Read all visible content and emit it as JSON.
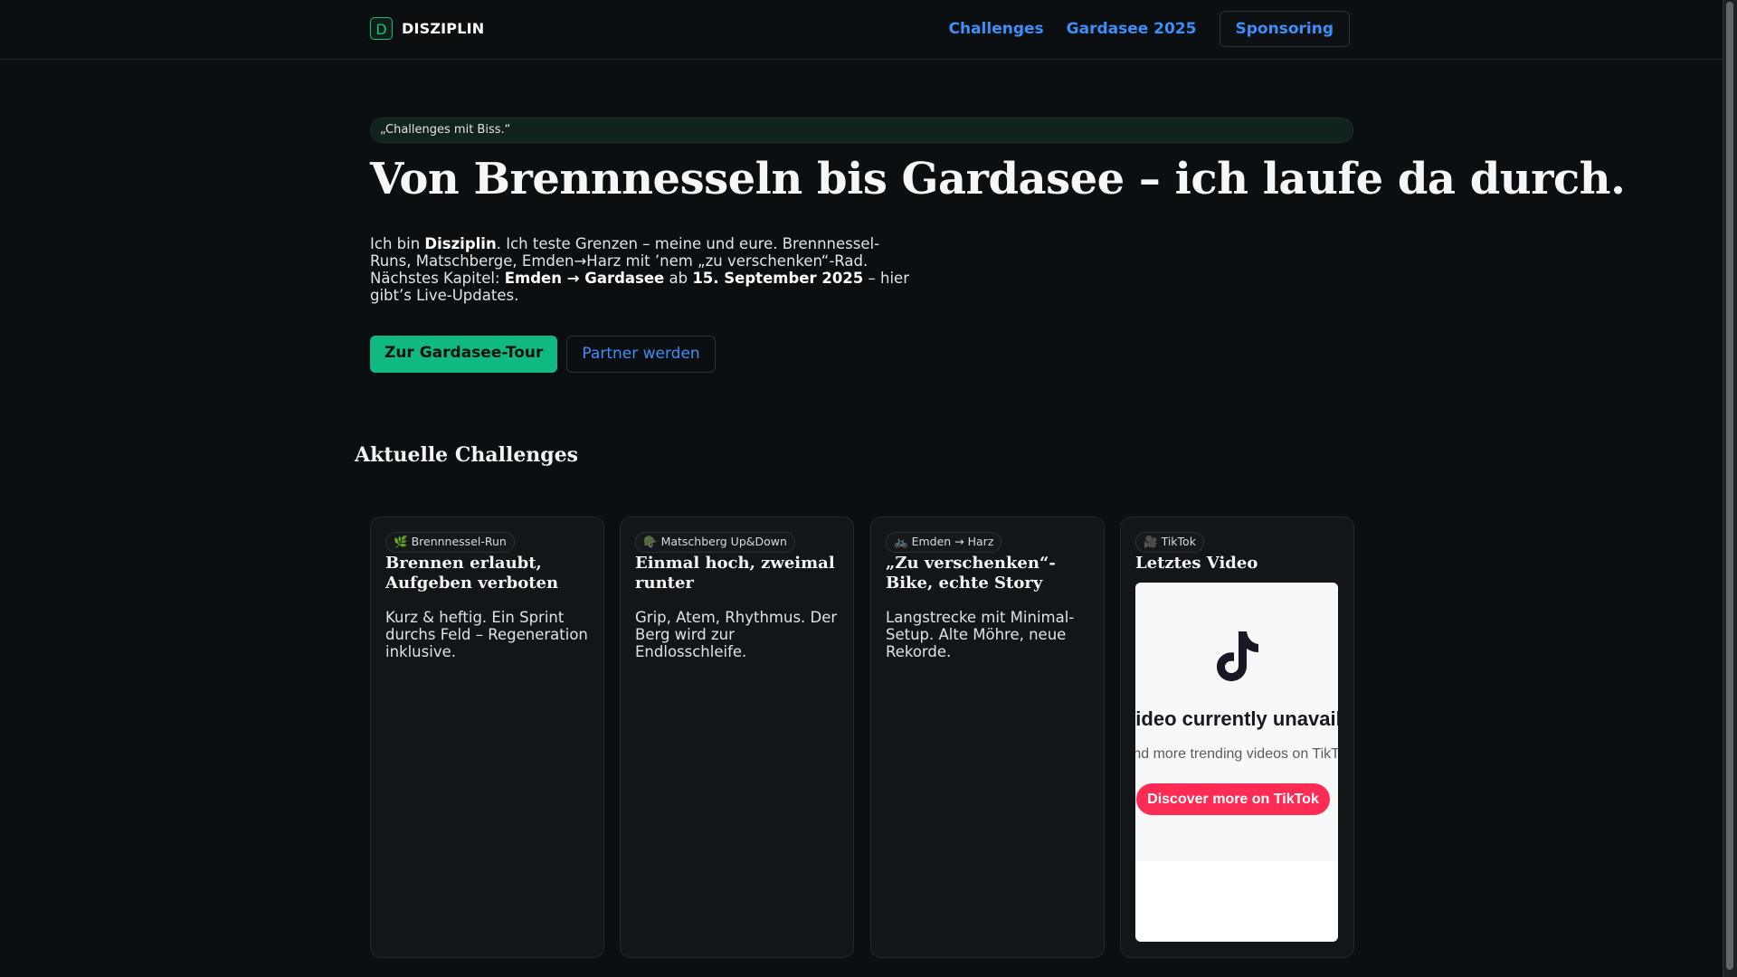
{
  "header": {
    "logo_letter": "D",
    "brand": "DISZIPLIN",
    "nav": [
      "Challenges",
      "Gardasee 2025"
    ],
    "sponsor_button": "Sponsoring"
  },
  "hero": {
    "tagline": "„Challenges mit Biss.“",
    "title": "Von Brennnesseln bis Gardasee – ich laufe da durch.",
    "intro": {
      "p1": "Ich bin ",
      "name": "Disziplin",
      "p2": ". Ich teste Grenzen – meine und eure. Brennnessel-Runs, Matschberge, Emden→Harz mit ’nem „zu verschenken“-Rad. Nächstes Kapitel: ",
      "route": "Emden → Gardasee",
      "p3": " ab ",
      "date": "15. September 2025",
      "p4": " – hier gibt’s Live-Updates."
    },
    "primary_cta": "Zur Gardasee-Tour",
    "secondary_cta": "Partner werden"
  },
  "challenges": {
    "heading": "Aktuelle Challenges",
    "cards": [
      {
        "tag_icon": "🌿",
        "tag": "Brennnessel-Run",
        "title": "Brennen erlaubt, Aufgeben verboten",
        "text": "Kurz & heftig. Ein Sprint durchs Feld – Regeneration inklusive."
      },
      {
        "tag_icon": "🪖",
        "tag": "Matschberg Up&Down",
        "title": "Einmal hoch, zweimal runter",
        "text": "Grip, Atem, Rhythmus. Der Berg wird zur Endlosschleife."
      },
      {
        "tag_icon": "🚲",
        "tag": "Emden → Harz",
        "title": "„Zu verschenken“-Bike, echte Story",
        "text": "Langstrecke mit Minimal-Setup. Alte Möhre, neue Rekorde."
      },
      {
        "tag_icon": "🎥",
        "tag": "TikTok",
        "title": "Letztes Video",
        "embed": {
          "headline": "Video currently unavailable",
          "subline": "Find more trending videos on TikTok",
          "button": "Discover more on TikTok",
          "accent": "#fe2c55"
        }
      }
    ]
  },
  "colors": {
    "background": "#0b0f11",
    "accent_green": "#10b981",
    "link_blue": "#3d8ef7"
  }
}
